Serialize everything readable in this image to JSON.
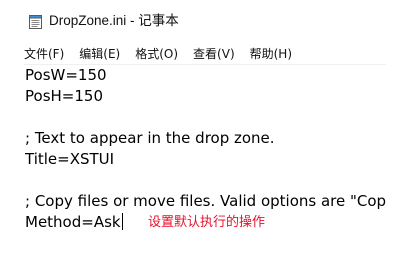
{
  "window": {
    "title": "DropZone.ini - 记事本",
    "icon": "notepad-icon"
  },
  "menu": {
    "items": [
      {
        "label": "文件(F)"
      },
      {
        "label": "编辑(E)"
      },
      {
        "label": "格式(O)"
      },
      {
        "label": "查看(V)"
      },
      {
        "label": "帮助(H)"
      }
    ]
  },
  "editor": {
    "lines": [
      "PosW=150",
      "PosH=150",
      "",
      "; Text to appear in the drop zone.",
      "Title=XSTUI",
      "",
      "; Copy files or move files.  Valid options are \"Copy\", \"Move\", and \"Ask\".",
      "Method=Ask"
    ]
  },
  "annotation": {
    "text": "设置默认执行的操作",
    "color": "#e8102a"
  }
}
